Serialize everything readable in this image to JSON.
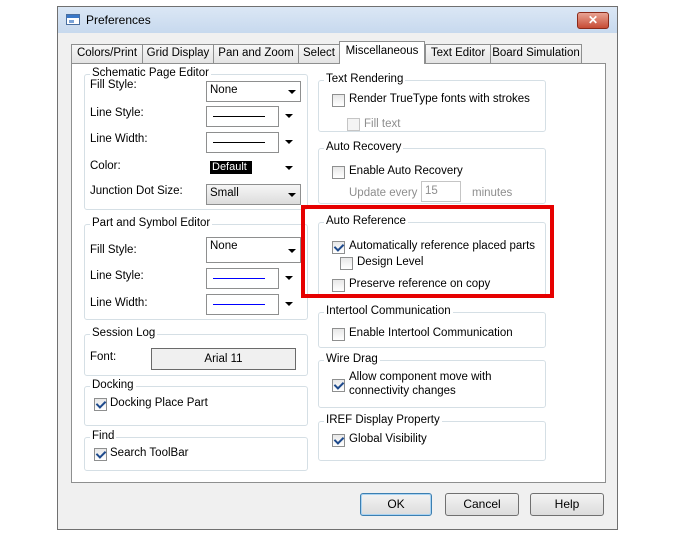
{
  "window": {
    "title": "Preferences",
    "close_glyph": "✕"
  },
  "tabs": [
    {
      "label": "Colors/Print"
    },
    {
      "label": "Grid Display"
    },
    {
      "label": "Pan and Zoom"
    },
    {
      "label": "Select"
    },
    {
      "label": "Miscellaneous",
      "active": true
    },
    {
      "label": "Text Editor"
    },
    {
      "label": "Board Simulation"
    }
  ],
  "schematic": {
    "title": "Schematic Page Editor",
    "fill_style_label": "Fill Style:",
    "fill_style_value": "None",
    "line_style_label": "Line Style:",
    "line_width_label": "Line Width:",
    "color_label": "Color:",
    "color_value": "Default",
    "junction_label": "Junction Dot Size:",
    "junction_value": "Small"
  },
  "part_symbol": {
    "title": "Part and Symbol Editor",
    "fill_style_label": "Fill Style:",
    "fill_style_value": "None",
    "line_style_label": "Line Style:",
    "line_width_label": "Line Width:"
  },
  "session_log": {
    "title": "Session Log",
    "font_label": "Font:",
    "font_value": "Arial 11"
  },
  "docking": {
    "title": "Docking",
    "place_part_label": "Docking Place Part",
    "place_part_checked": true
  },
  "find": {
    "title": "Find",
    "search_toolbar_label": "Search ToolBar",
    "search_toolbar_checked": true
  },
  "text_rendering": {
    "title": "Text Rendering",
    "truetype_label": "Render TrueType fonts with strokes",
    "truetype_checked": false,
    "fill_text_label": "Fill text",
    "fill_text_checked": false
  },
  "auto_recovery": {
    "title": "Auto Recovery",
    "enable_label": "Enable Auto Recovery",
    "enable_checked": false,
    "update_every_label": "Update every",
    "update_every_value": "15",
    "minutes_label": "minutes"
  },
  "auto_reference": {
    "title": "Auto Reference",
    "auto_ref_label": "Automatically reference placed parts",
    "auto_ref_checked": true,
    "design_level_label": "Design Level",
    "design_level_checked": false,
    "preserve_label": "Preserve reference on copy",
    "preserve_checked": false
  },
  "intertool": {
    "title": "Intertool Communication",
    "enable_label": "Enable Intertool Communication",
    "enable_checked": false
  },
  "wire_drag": {
    "title": "Wire Drag",
    "allow_line1": "Allow component move with",
    "allow_line2": "connectivity changes",
    "allow_checked": true
  },
  "iref": {
    "title": "IREF Display Property",
    "global_label": "Global Visibility",
    "global_checked": true
  },
  "buttons": {
    "ok": "OK",
    "cancel": "Cancel",
    "help": "Help"
  },
  "colors": {
    "highlight": "#e60000",
    "schematic_line": "#000000",
    "part_line": "#0000ff"
  }
}
